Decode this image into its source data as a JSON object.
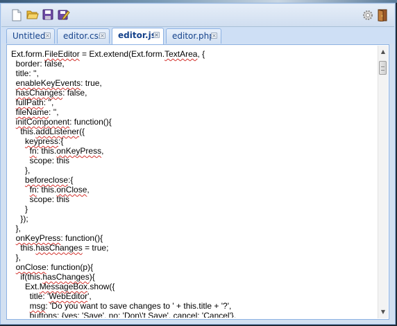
{
  "toolbar": {
    "icons": [
      "new-file-icon",
      "open-folder-icon",
      "save-icon",
      "save-as-icon",
      "settings-gear-icon",
      "exit-door-icon"
    ]
  },
  "tabs": [
    {
      "label": "Untitled",
      "active": false
    },
    {
      "label": "editor.css",
      "active": false
    },
    {
      "label": "editor.js",
      "active": true
    },
    {
      "label": "editor.php",
      "active": false
    }
  ],
  "editor": {
    "lines": [
      "Ext.form.FileEditor = Ext.extend(Ext.form.TextArea, {",
      "  border: false,",
      "  title: '',",
      "  enableKeyEvents: true,",
      "  hasChanges: false,",
      "  fullPath: '',",
      "  fileName: '',",
      "  initComponent: function(){",
      "    this.addListener({",
      "      keypress:{",
      "        fn: this.onKeyPress,",
      "        scope: this",
      "      },",
      "      beforeclose:{",
      "        fn: this.onClose,",
      "        scope: this",
      "      }",
      "    });",
      "  },",
      "  onKeyPress: function(){",
      "    this.hasChanges = true;",
      "  },",
      "  onClose: function(p){",
      "    if(this.hasChanges){",
      "      Ext.MessageBox.show({",
      "        title: 'WebEditor',",
      "        msg: 'Do you want to save changes to ' + this.title + '?',",
      "        buttons: {yes: 'Save', no: 'Don\\'t Save', cancel: 'Cancel'},"
    ],
    "misspelled_words": [
      "FileEditor",
      "TextArea",
      "enableKeyEvents",
      "hasChanges",
      "fullPath",
      "fileName",
      "initComponent",
      "addListener",
      "keypress",
      "fn",
      "onKeyPress",
      "beforeclose",
      "onClose",
      "MessageBox",
      "WebEditor",
      "msg"
    ]
  }
}
